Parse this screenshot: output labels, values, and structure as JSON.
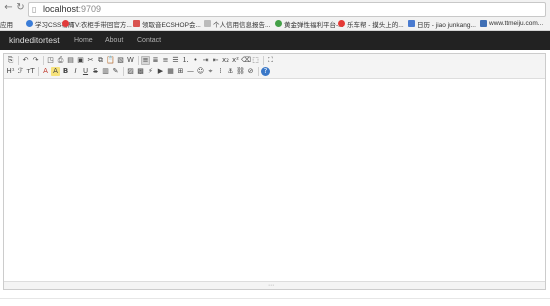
{
  "browser": {
    "url_host": "localhost",
    "url_port": ":9709",
    "back_icon": "arrow-left",
    "reload_icon": "reload",
    "page_icon": "document"
  },
  "bookmarks": [
    {
      "label": "应用",
      "icon": "",
      "color": "#4a7bd0"
    },
    {
      "label": "学习CSS布局",
      "icon": "●",
      "color": "#3b7dd8"
    },
    {
      "label": "TV:衣柜手带回官方...",
      "icon": "●",
      "color": "#e13b3b"
    },
    {
      "label": "领取音ECSHOP会...",
      "icon": "■",
      "color": "#d9534f"
    },
    {
      "label": "个人信用信息报告...",
      "icon": "□",
      "color": "#bbbbbb"
    },
    {
      "label": "黄金弹性福利平台-...",
      "icon": "●",
      "color": "#43a047"
    },
    {
      "label": "乐车帮 - 摸头上的...",
      "icon": "✦",
      "color": "#e53935"
    },
    {
      "label": "日历 - jiao junkang...",
      "icon": "▦",
      "color": "#4a7bd0"
    },
    {
      "label": "www.ttmeiju.com...",
      "icon": "■",
      "color": "#3f6fb5"
    }
  ],
  "navbar": {
    "brand": "kindeditortest",
    "links": [
      "Home",
      "About",
      "Contact"
    ]
  },
  "toolbar": {
    "row1": [
      "source-icon",
      "sep",
      "undo-icon",
      "redo-icon",
      "sep",
      "preview-icon",
      "print-icon",
      "template-icon",
      "code-icon",
      "cut-icon",
      "copy-icon",
      "paste-icon",
      "paste-plain-icon",
      "paste-word-icon",
      "sep",
      "align-left-icon",
      "align-center-icon",
      "align-right-icon",
      "align-justify-icon",
      "ordered-list-icon",
      "unordered-list-icon",
      "indent-icon",
      "outdent-icon",
      "subscript-icon",
      "superscript-icon",
      "clear-format-icon",
      "select-all-icon",
      "sep",
      "fullscreen-icon"
    ],
    "row2": [
      "heading-icon",
      "font-family-icon",
      "font-size-icon",
      "sep",
      "font-color-icon",
      "highlight-icon",
      "bold-icon",
      "italic-icon",
      "underline-icon",
      "strikethrough-icon",
      "line-height-icon",
      "remove-format-icon",
      "sep",
      "image-icon",
      "multi-image-icon",
      "flash-icon",
      "media-icon",
      "insert-file-icon",
      "table-icon",
      "horizontal-rule-icon",
      "emoticons-icon",
      "baidu-map-icon",
      "page-break-icon",
      "anchor-icon",
      "link-icon",
      "unlink-icon",
      "sep",
      "about-icon"
    ]
  },
  "toolbar_glyphs": {
    "source-icon": "⎘",
    "undo-icon": "↶",
    "redo-icon": "↷",
    "preview-icon": "◳",
    "print-icon": "⎙",
    "template-icon": "▤",
    "code-icon": "▣",
    "cut-icon": "✂",
    "copy-icon": "⧉",
    "paste-icon": "📋",
    "paste-plain-icon": "▧",
    "paste-word-icon": "W",
    "align-left-icon": "≡",
    "align-center-icon": "≣",
    "align-right-icon": "≡",
    "align-justify-icon": "☰",
    "ordered-list-icon": "⒈",
    "unordered-list-icon": "•",
    "indent-icon": "⇥",
    "outdent-icon": "⇤",
    "subscript-icon": "x₂",
    "superscript-icon": "x²",
    "clear-format-icon": "⌫",
    "select-all-icon": "⬚",
    "fullscreen-icon": "⛶",
    "heading-icon": "H¹",
    "font-family-icon": "ℱ",
    "font-size-icon": "тT",
    "font-color-icon": "A",
    "highlight-icon": "A",
    "bold-icon": "B",
    "italic-icon": "I",
    "underline-icon": "U",
    "strikethrough-icon": "S",
    "line-height-icon": "▥",
    "remove-format-icon": "✎",
    "image-icon": "▨",
    "multi-image-icon": "▩",
    "flash-icon": "⚡",
    "media-icon": "▶",
    "insert-file-icon": "▦",
    "table-icon": "⊞",
    "horizontal-rule-icon": "—",
    "emoticons-icon": "☺",
    "baidu-map-icon": "⌖",
    "page-break-icon": "⁞",
    "anchor-icon": "⚓",
    "link-icon": "⛓",
    "unlink-icon": "⊘",
    "about-icon": "?"
  },
  "editor": {
    "content": "",
    "resize_icon": "⋯"
  }
}
